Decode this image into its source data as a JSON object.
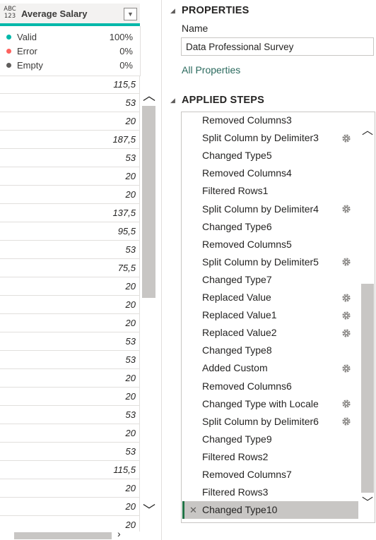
{
  "column": {
    "type_icon_top": "ABC",
    "type_icon_bottom": "123",
    "title": "Average Salary",
    "dropdown_icon": "chevron-down-icon"
  },
  "quality": [
    {
      "label": "Valid",
      "value": "100%",
      "color": "#01b8aa"
    },
    {
      "label": "Error",
      "value": "0%",
      "color": "#fd625e"
    },
    {
      "label": "Empty",
      "value": "0%",
      "color": "#605e5c"
    }
  ],
  "rows": [
    "115,5",
    "53",
    "20",
    "187,5",
    "53",
    "20",
    "20",
    "137,5",
    "95,5",
    "53",
    "75,5",
    "20",
    "20",
    "20",
    "53",
    "53",
    "20",
    "20",
    "53",
    "20",
    "53",
    "115,5",
    "20",
    "20",
    "20"
  ],
  "properties": {
    "title": "PROPERTIES",
    "name_label": "Name",
    "name_value": "Data Professional Survey",
    "all_properties_link": "All Properties"
  },
  "applied_steps": {
    "title": "APPLIED STEPS",
    "steps": [
      {
        "label": "Removed Columns3",
        "gear": false
      },
      {
        "label": "Split Column by Delimiter3",
        "gear": true
      },
      {
        "label": "Changed Type5",
        "gear": false
      },
      {
        "label": "Removed Columns4",
        "gear": false
      },
      {
        "label": "Filtered Rows1",
        "gear": false
      },
      {
        "label": "Split Column by Delimiter4",
        "gear": true
      },
      {
        "label": "Changed Type6",
        "gear": false
      },
      {
        "label": "Removed Columns5",
        "gear": false
      },
      {
        "label": "Split Column by Delimiter5",
        "gear": true
      },
      {
        "label": "Changed Type7",
        "gear": false
      },
      {
        "label": "Replaced Value",
        "gear": true
      },
      {
        "label": "Replaced Value1",
        "gear": true
      },
      {
        "label": "Replaced Value2",
        "gear": true
      },
      {
        "label": "Changed Type8",
        "gear": false
      },
      {
        "label": "Added Custom",
        "gear": true
      },
      {
        "label": "Removed Columns6",
        "gear": false
      },
      {
        "label": "Changed Type with Locale",
        "gear": true
      },
      {
        "label": "Split Column by Delimiter6",
        "gear": true
      },
      {
        "label": "Changed Type9",
        "gear": false
      },
      {
        "label": "Filtered Rows2",
        "gear": false
      },
      {
        "label": "Removed Columns7",
        "gear": false
      },
      {
        "label": "Filtered Rows3",
        "gear": false
      },
      {
        "label": "Changed Type10",
        "gear": false,
        "selected": true
      }
    ]
  }
}
